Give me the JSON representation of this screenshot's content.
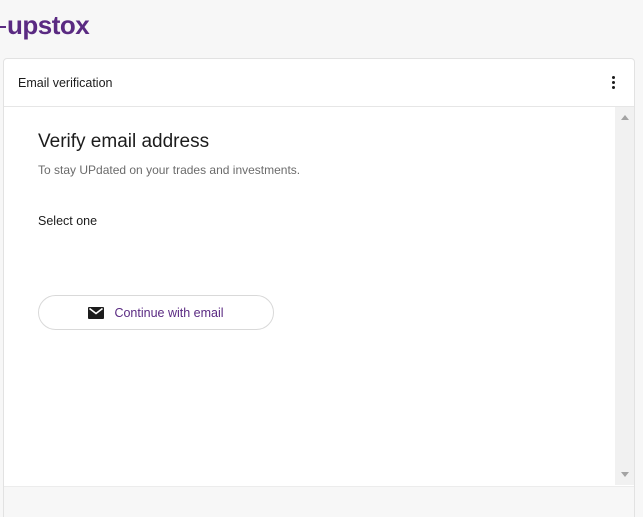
{
  "brand": {
    "logo_text": "upstox",
    "color": "#5a2a82"
  },
  "panel": {
    "title": "Email verification",
    "menu_icon": "more-vertical-icon"
  },
  "content": {
    "heading": "Verify email address",
    "subtitle": "To stay UPdated on your trades and investments.",
    "select_label": "Select one",
    "email_button": {
      "label": "Continue with email",
      "icon": "mail-icon"
    }
  }
}
